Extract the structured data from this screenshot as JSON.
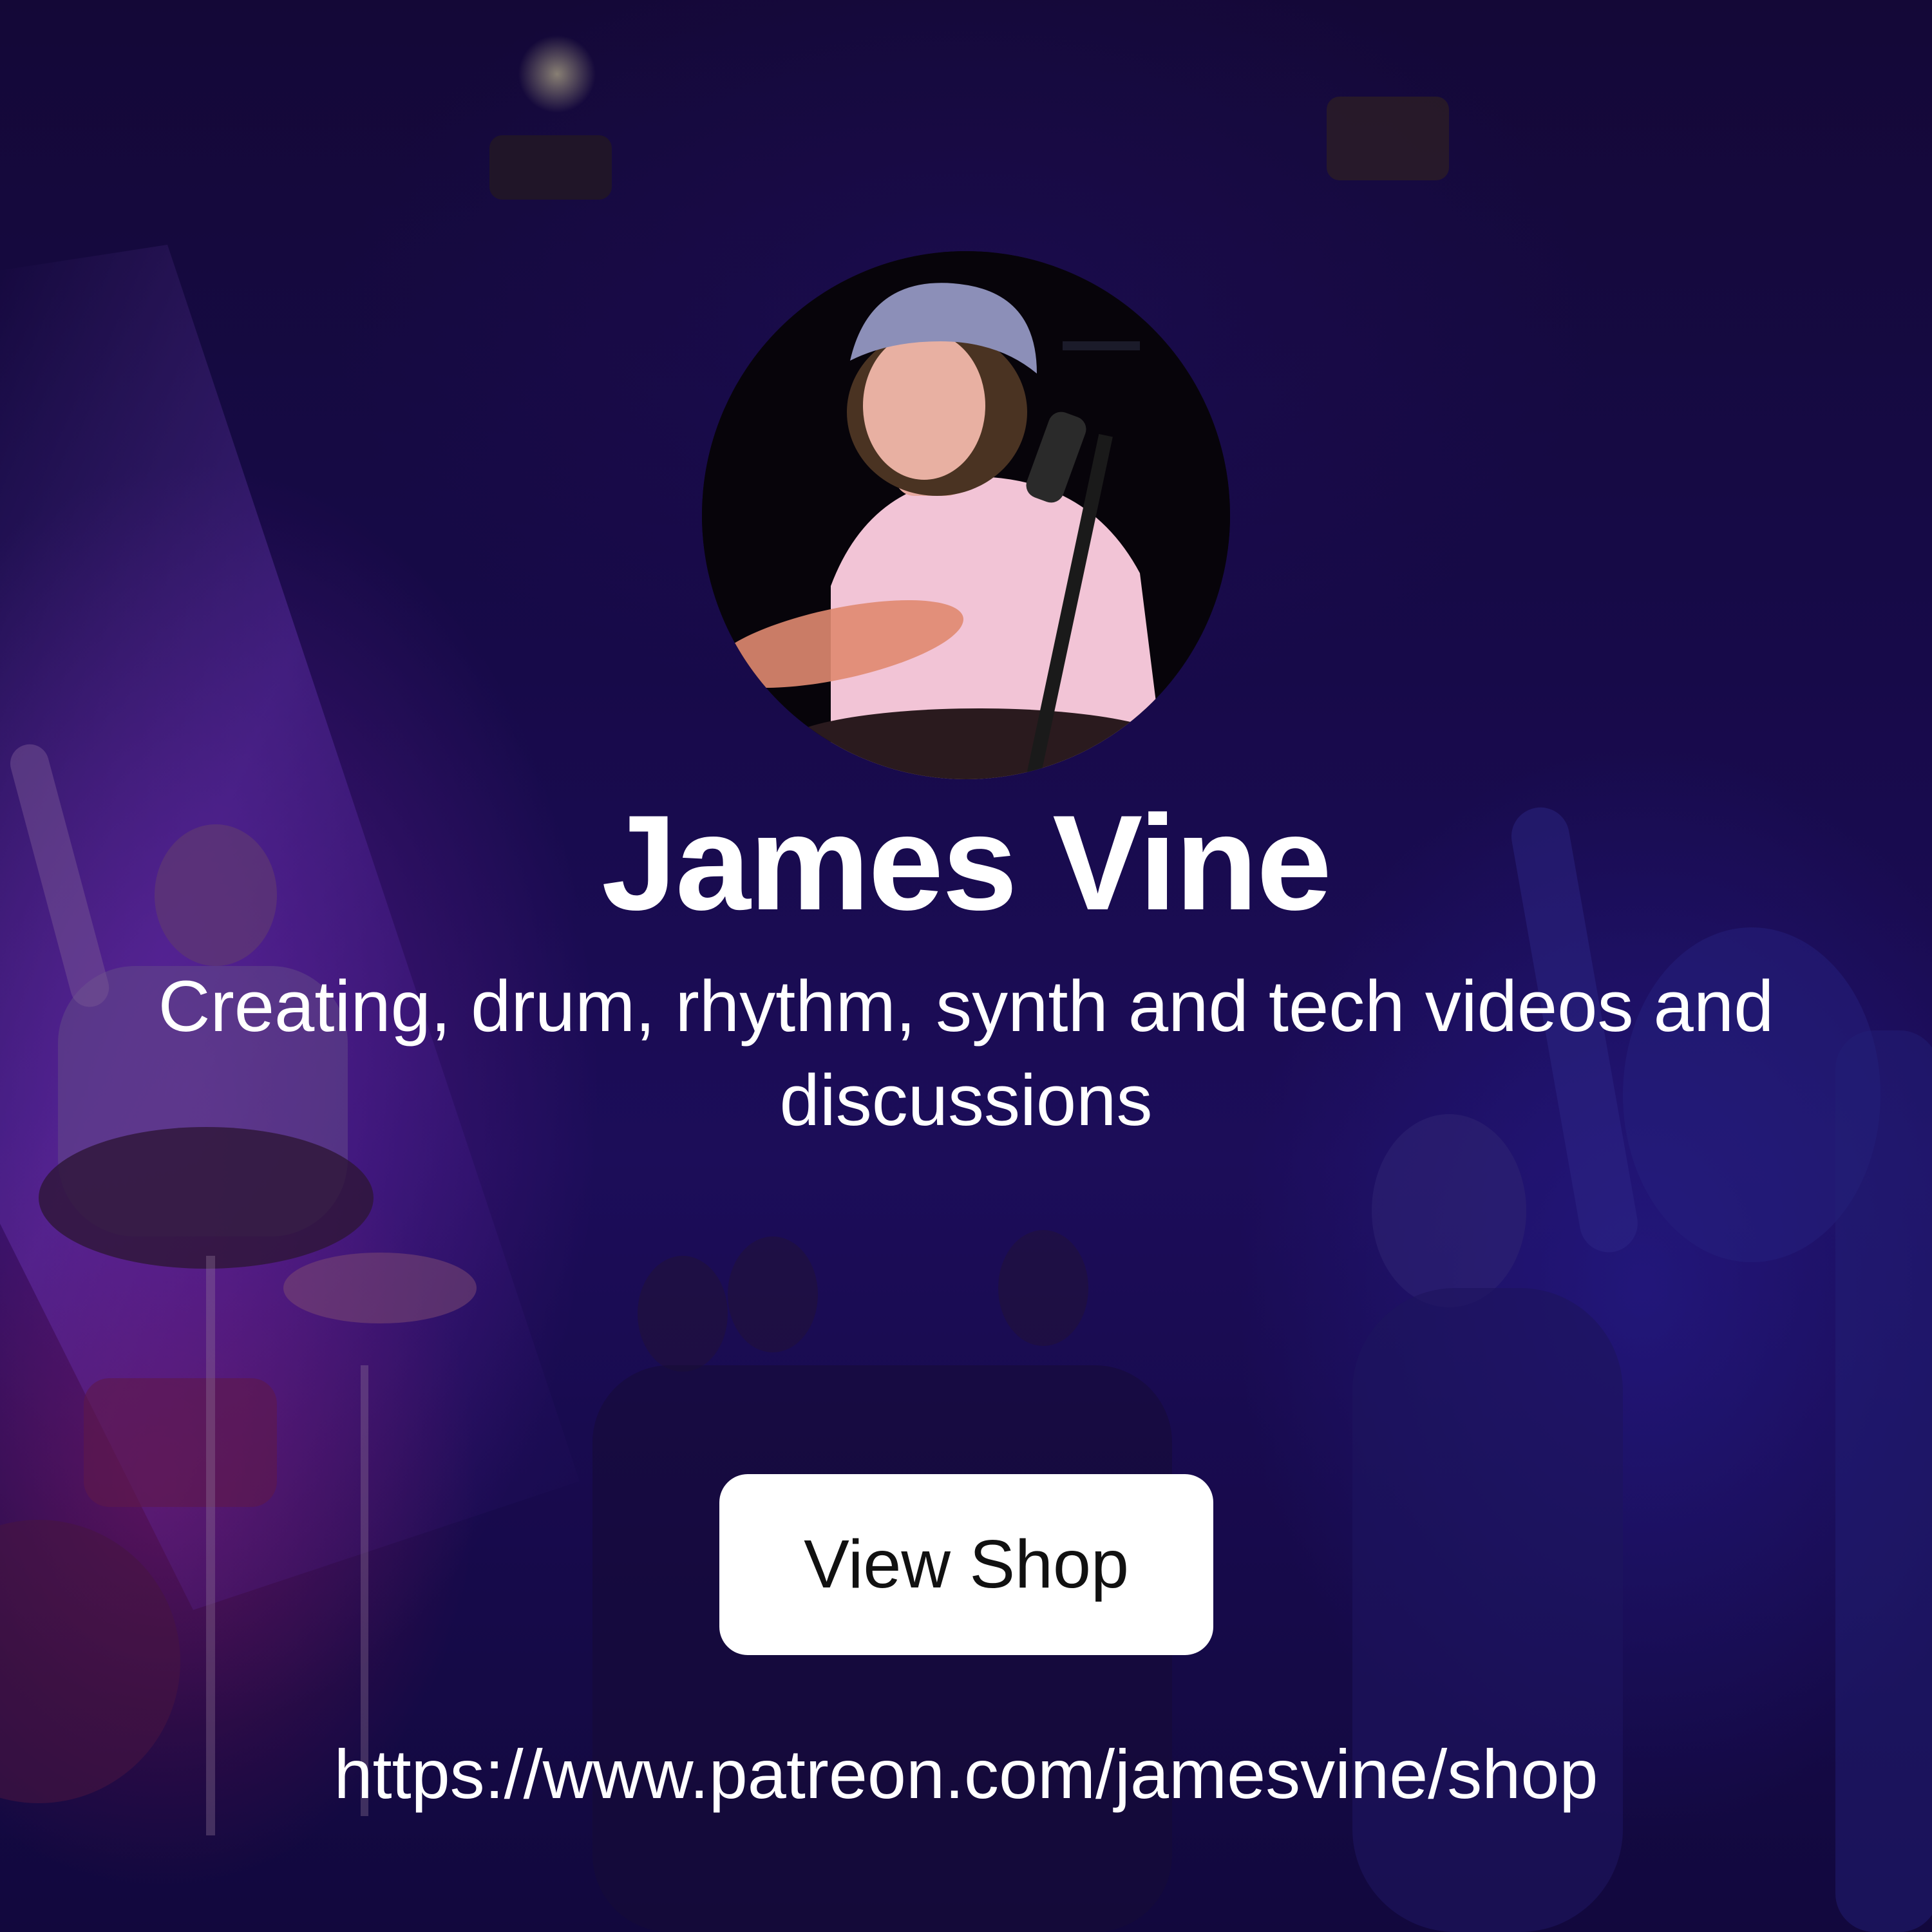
{
  "profile": {
    "name": "James Vine",
    "tagline": "Creating, drum, rhythm, synth and tech videos and discussions",
    "avatar_icon": "profile-photo"
  },
  "cta": {
    "label": "View Shop"
  },
  "link": {
    "url": "https://www.patreon.com/jamesvine/shop"
  },
  "colors": {
    "background": "#1b0d55",
    "text": "#ffffff",
    "button_bg": "#ffffff",
    "button_text": "#111111"
  }
}
